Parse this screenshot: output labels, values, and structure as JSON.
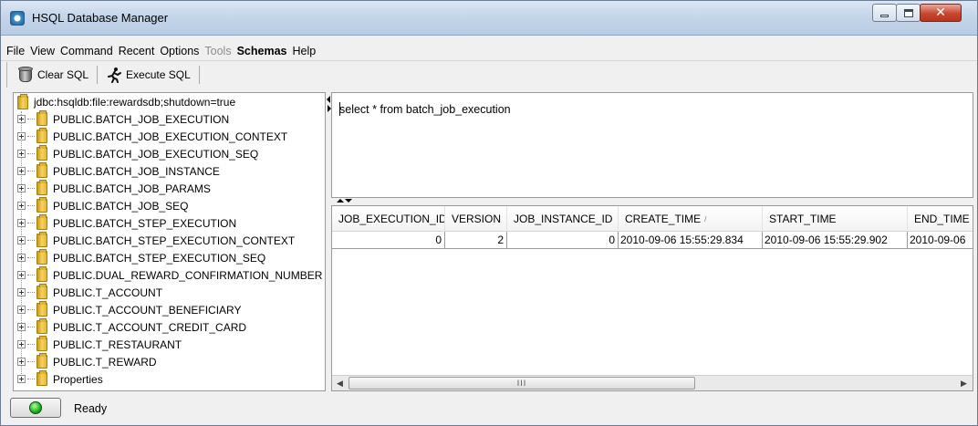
{
  "window": {
    "title": "HSQL Database Manager",
    "icon": "hsql-app-icon"
  },
  "menu": {
    "items": [
      {
        "label": "File",
        "enabled": true
      },
      {
        "label": "View",
        "enabled": true
      },
      {
        "label": "Command",
        "enabled": true
      },
      {
        "label": "Recent",
        "enabled": true
      },
      {
        "label": "Options",
        "enabled": true
      },
      {
        "label": "Tools",
        "enabled": false
      },
      {
        "label": "Schemas",
        "enabled": true
      },
      {
        "label": "Help",
        "enabled": true
      }
    ]
  },
  "toolbar": {
    "clear_sql_label": "Clear SQL",
    "execute_sql_label": "Execute SQL"
  },
  "tree": {
    "root": "jdbc:hsqldb:file:rewardsdb;shutdown=true",
    "items": [
      "PUBLIC.BATCH_JOB_EXECUTION",
      "PUBLIC.BATCH_JOB_EXECUTION_CONTEXT",
      "PUBLIC.BATCH_JOB_EXECUTION_SEQ",
      "PUBLIC.BATCH_JOB_INSTANCE",
      "PUBLIC.BATCH_JOB_PARAMS",
      "PUBLIC.BATCH_JOB_SEQ",
      "PUBLIC.BATCH_STEP_EXECUTION",
      "PUBLIC.BATCH_STEP_EXECUTION_CONTEXT",
      "PUBLIC.BATCH_STEP_EXECUTION_SEQ",
      "PUBLIC.DUAL_REWARD_CONFIRMATION_NUMBER",
      "PUBLIC.T_ACCOUNT",
      "PUBLIC.T_ACCOUNT_BENEFICIARY",
      "PUBLIC.T_ACCOUNT_CREDIT_CARD",
      "PUBLIC.T_RESTAURANT",
      "PUBLIC.T_REWARD",
      "Properties"
    ]
  },
  "sql_editor": {
    "text": "select * from batch_job_execution"
  },
  "results": {
    "columns": [
      "JOB_EXECUTION_ID",
      "VERSION",
      "JOB_INSTANCE_ID",
      "CREATE_TIME",
      "START_TIME",
      "END_TIME"
    ],
    "sorted_column": "CREATE_TIME",
    "rows": [
      [
        "0",
        "2",
        "0",
        "2010-09-06 15:55:29.834",
        "2010-09-06 15:55:29.902",
        "2010-09-06"
      ]
    ],
    "scroll_thumb_label": "III"
  },
  "status": {
    "text": "Ready",
    "indicator_color": "#18b11a"
  }
}
